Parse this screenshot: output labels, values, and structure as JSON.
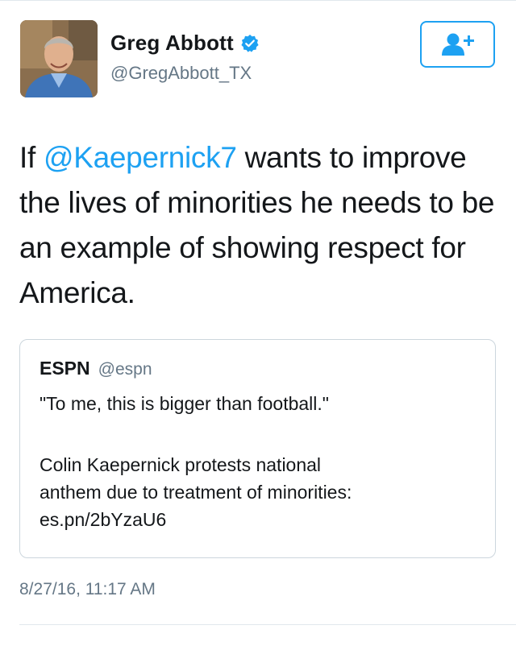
{
  "author": {
    "name": "Greg Abbott",
    "handle": "@GregAbbott_TX",
    "verified_icon": "verified-badge-icon",
    "avatar_icon": "profile-photo"
  },
  "follow_button": {
    "icon": "follow-user-plus-icon"
  },
  "tweet": {
    "prefix": "If ",
    "mention": "@Kaepernick7",
    "suffix": " wants to improve the lives of minorities he needs to be an example of showing respect for America."
  },
  "quoted": {
    "name": "ESPN",
    "handle": "@espn",
    "quote": "\"To me, this is bigger than football.\"",
    "body_lines": [
      "Colin Kaepernick protests national",
      "anthem due to treatment of minorities:",
      "es.pn/2bYzaU6"
    ]
  },
  "timestamp": "8/27/16, 11:17 AM",
  "colors": {
    "accent": "#1da1f2",
    "text": "#14171a",
    "secondary": "#657786",
    "border": "#ccd6dd"
  }
}
